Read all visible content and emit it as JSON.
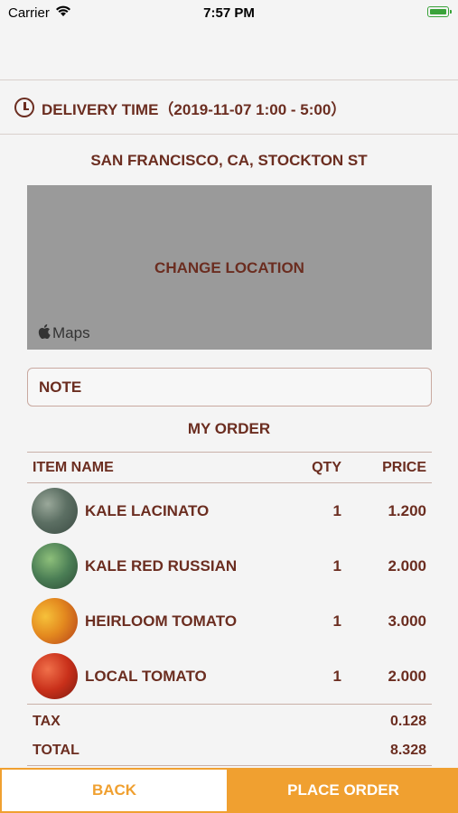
{
  "status_bar": {
    "carrier": "Carrier",
    "time": "7:57 PM"
  },
  "delivery": {
    "label": "DELIVERY TIME（2019-11-07 1:00 - 5:00）"
  },
  "location": {
    "title": "SAN FRANCISCO, CA, STOCKTON ST",
    "change_label": "CHANGE LOCATION",
    "maps_label": "Maps"
  },
  "note": {
    "placeholder": "NOTE"
  },
  "order": {
    "title": "MY ORDER",
    "columns": {
      "name": "ITEM NAME",
      "qty": "QTY",
      "price": "PRICE"
    },
    "items": [
      {
        "name": "KALE LACINATO",
        "qty": "1",
        "price": "1.200"
      },
      {
        "name": "KALE RED RUSSIAN",
        "qty": "1",
        "price": "2.000"
      },
      {
        "name": "HEIRLOOM TOMATO",
        "qty": "1",
        "price": "3.000"
      },
      {
        "name": "LOCAL TOMATO",
        "qty": "1",
        "price": "2.000"
      }
    ],
    "tax_label": "TAX",
    "tax_value": "0.128",
    "total_label": "TOTAL",
    "total_value": "8.328"
  },
  "footer": {
    "back_label": "BACK",
    "place_order_label": "PLACE ORDER"
  },
  "colors": {
    "brand_text": "#6b2d20",
    "accent": "#f0a030",
    "map_bg": "#9a9a9a"
  }
}
